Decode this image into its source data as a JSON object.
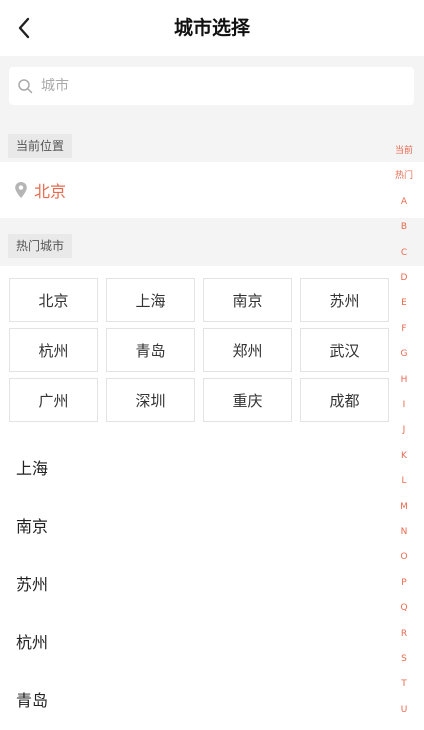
{
  "header": {
    "title": "城市选择",
    "back_icon": "chevron-left-icon"
  },
  "search": {
    "placeholder": "城市",
    "value": "",
    "icon": "search-icon"
  },
  "current_location": {
    "section_label": "当前位置",
    "city": "北京",
    "icon": "map-pin-icon"
  },
  "hot_cities": {
    "section_label": "热门城市",
    "items": [
      "北京",
      "上海",
      "南京",
      "苏州",
      "杭州",
      "青岛",
      "郑州",
      "武汉",
      "广州",
      "深圳",
      "重庆",
      "成都"
    ]
  },
  "city_list": [
    "上海",
    "南京",
    "苏州",
    "杭州",
    "青岛"
  ],
  "index": [
    "当前",
    "热门",
    "A",
    "B",
    "C",
    "D",
    "E",
    "F",
    "G",
    "H",
    "I",
    "J",
    "K",
    "L",
    "M",
    "N",
    "O",
    "P",
    "Q",
    "R",
    "S",
    "T",
    "U"
  ],
  "colors": {
    "accent": "#e86a4f",
    "section_bg": "#f4f4f4",
    "tag_bg": "#e9e9e9",
    "border": "#e3e3e3"
  }
}
